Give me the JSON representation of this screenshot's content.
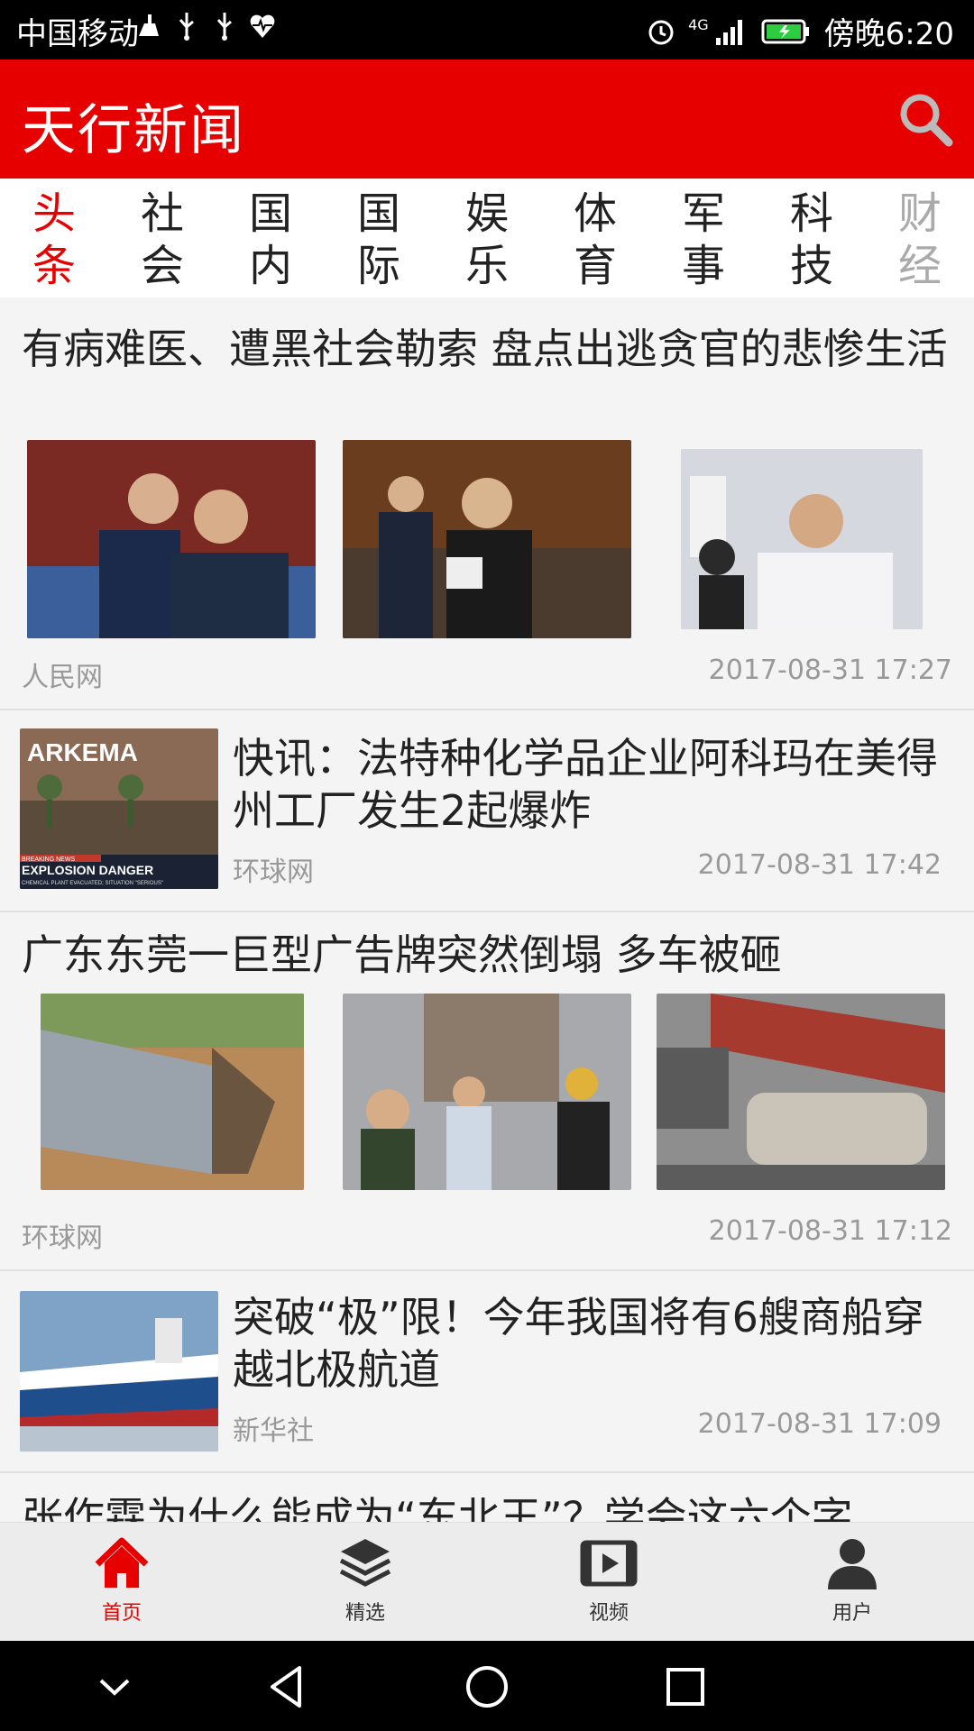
{
  "status_bar": {
    "carrier": "中国移动",
    "network": "4G",
    "time": "傍晚6:20"
  },
  "header": {
    "title": "天行新闻"
  },
  "tabs": [
    {
      "line1": "头",
      "line2": "条"
    },
    {
      "line1": "社",
      "line2": "会"
    },
    {
      "line1": "国",
      "line2": "内"
    },
    {
      "line1": "国",
      "line2": "际"
    },
    {
      "line1": "娱",
      "line2": "乐"
    },
    {
      "line1": "体",
      "line2": "育"
    },
    {
      "line1": "军",
      "line2": "事"
    },
    {
      "line1": "科",
      "line2": "技"
    },
    {
      "line1": "财",
      "line2": "经"
    }
  ],
  "feed": [
    {
      "headline": "有病难医、遭黑社会勒索 盘点出逃贪官的悲惨生活",
      "source": "人民网",
      "time": "2017-08-31 17:27"
    },
    {
      "headline": "快讯：法特种化学品企业阿科玛在美得州工厂发生2起爆炸",
      "source": "环球网",
      "time": "2017-08-31 17:42",
      "thumb_text": {
        "brand": "ARKEMA",
        "breaking": "BREAKING NEWS",
        "title": "EXPLOSION DANGER",
        "sub": "CHEMICAL PLANT EVACUATED; SITUATION \"SERIOUS\""
      }
    },
    {
      "headline": "广东东莞一巨型广告牌突然倒塌 多车被砸",
      "source": "环球网",
      "time": "2017-08-31 17:12"
    },
    {
      "headline": "突破“极”限！今年我国将有6艘商船穿越北极航道",
      "source": "新华社",
      "time": "2017-08-31 17:09"
    },
    {
      "headline": "张作霖为什么能成为“东北王”？学会这六个字"
    }
  ],
  "bottom_nav": [
    {
      "label": "首页",
      "icon": "home-icon"
    },
    {
      "label": "精选",
      "icon": "layers-icon"
    },
    {
      "label": "视频",
      "icon": "video-icon"
    },
    {
      "label": "用户",
      "icon": "user-icon"
    }
  ],
  "colors": {
    "brand_red": "#e60000",
    "text_dark": "#222222",
    "text_muted": "#999999"
  }
}
